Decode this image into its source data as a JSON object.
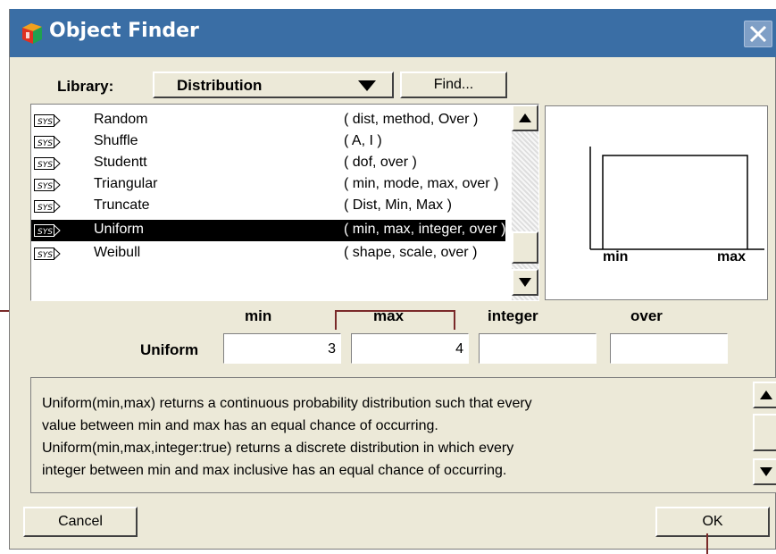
{
  "window": {
    "title": "Object Finder"
  },
  "library": {
    "label": "Library:",
    "selected": "Distribution",
    "find_label": "Find..."
  },
  "functions": [
    {
      "name": "Random",
      "params": "( dist, method, Over )"
    },
    {
      "name": "Shuffle",
      "params": "( A, I )"
    },
    {
      "name": "Studentt",
      "params": "( dof, over )"
    },
    {
      "name": "Triangular",
      "params": "( min, mode, max, over )"
    },
    {
      "name": "Truncate",
      "params": "( Dist, Min, Max )"
    },
    {
      "name": "Uniform",
      "params": "( min, max, integer, over )",
      "selected": true
    },
    {
      "name": "Weibull",
      "params": "( shape, scale, over )"
    }
  ],
  "preview": {
    "min_label": "min",
    "max_label": "max"
  },
  "parameters": {
    "function_name": "Uniform",
    "headers": [
      "min",
      "max",
      "integer",
      "over"
    ],
    "values": [
      "3",
      "4",
      "",
      ""
    ]
  },
  "description": [
    "Uniform(min,max) returns a continuous probability distribution such that every",
    "value between min and max has an equal chance of occurring.",
    "Uniform(min,max,integer:true) returns a discrete distribution in which every",
    "integer between min and max inclusive has an equal chance of occurring."
  ],
  "buttons": {
    "cancel": "Cancel",
    "ok": "OK"
  },
  "colors": {
    "title_bar": "#3a6ea5",
    "dialog_bg": "#ece9d8",
    "selection": "#000000",
    "callout": "#7a2a2a"
  }
}
